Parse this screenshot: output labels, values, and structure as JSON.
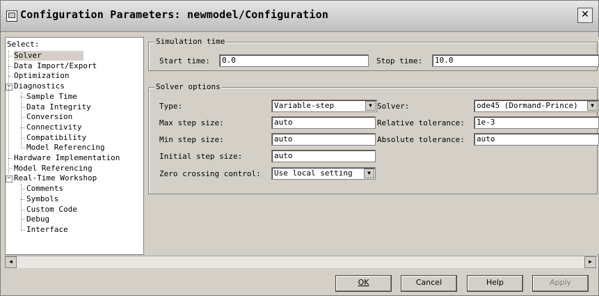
{
  "window": {
    "title": "Configuration Parameters: newmodel/Configuration",
    "close_glyph": "✕"
  },
  "tree": {
    "header": "Select:",
    "items": [
      {
        "label": "Solver",
        "level": 1,
        "selected": true
      },
      {
        "label": "Data Import/Export",
        "level": 1
      },
      {
        "label": "Optimization",
        "level": 1
      },
      {
        "label": "Diagnostics",
        "level": 1,
        "expander": "−"
      },
      {
        "label": "Sample Time",
        "level": 2
      },
      {
        "label": "Data Integrity",
        "level": 2
      },
      {
        "label": "Conversion",
        "level": 2
      },
      {
        "label": "Connectivity",
        "level": 2
      },
      {
        "label": "Compatibility",
        "level": 2
      },
      {
        "label": "Model Referencing",
        "level": 2
      },
      {
        "label": "Hardware Implementation",
        "level": 1
      },
      {
        "label": "Model Referencing",
        "level": 1
      },
      {
        "label": "Real-Time Workshop",
        "level": 1,
        "expander": "−"
      },
      {
        "label": "Comments",
        "level": 2
      },
      {
        "label": "Symbols",
        "level": 2
      },
      {
        "label": "Custom Code",
        "level": 2
      },
      {
        "label": "Debug",
        "level": 2
      },
      {
        "label": "Interface",
        "level": 2
      }
    ]
  },
  "simulation_time": {
    "title": "Simulation time",
    "start_label": "Start time:",
    "start_value": "0.0",
    "stop_label": "Stop time:",
    "stop_value": "10.0"
  },
  "solver_options": {
    "title": "Solver options",
    "type_label": "Type:",
    "type_value": "Variable-step",
    "solver_label": "Solver:",
    "solver_value": "ode45 (Dormand-Prince)",
    "max_step_label": "Max step size:",
    "max_step_value": "auto",
    "rel_tol_label": "Relative tolerance:",
    "rel_tol_value": "1e-3",
    "min_step_label": "Min step size:",
    "min_step_value": "auto",
    "abs_tol_label": "Absolute tolerance:",
    "abs_tol_value": "auto",
    "init_step_label": "Initial step size:",
    "init_step_value": "auto",
    "zero_cross_label": "Zero crossing control:",
    "zero_cross_value": "Use local setting"
  },
  "scrollbar": {
    "left_glyph": "◀",
    "right_glyph": "▶"
  },
  "combo_arrow": "▼",
  "buttons": {
    "ok": "OK",
    "cancel": "Cancel",
    "help": "Help",
    "apply": "Apply"
  }
}
